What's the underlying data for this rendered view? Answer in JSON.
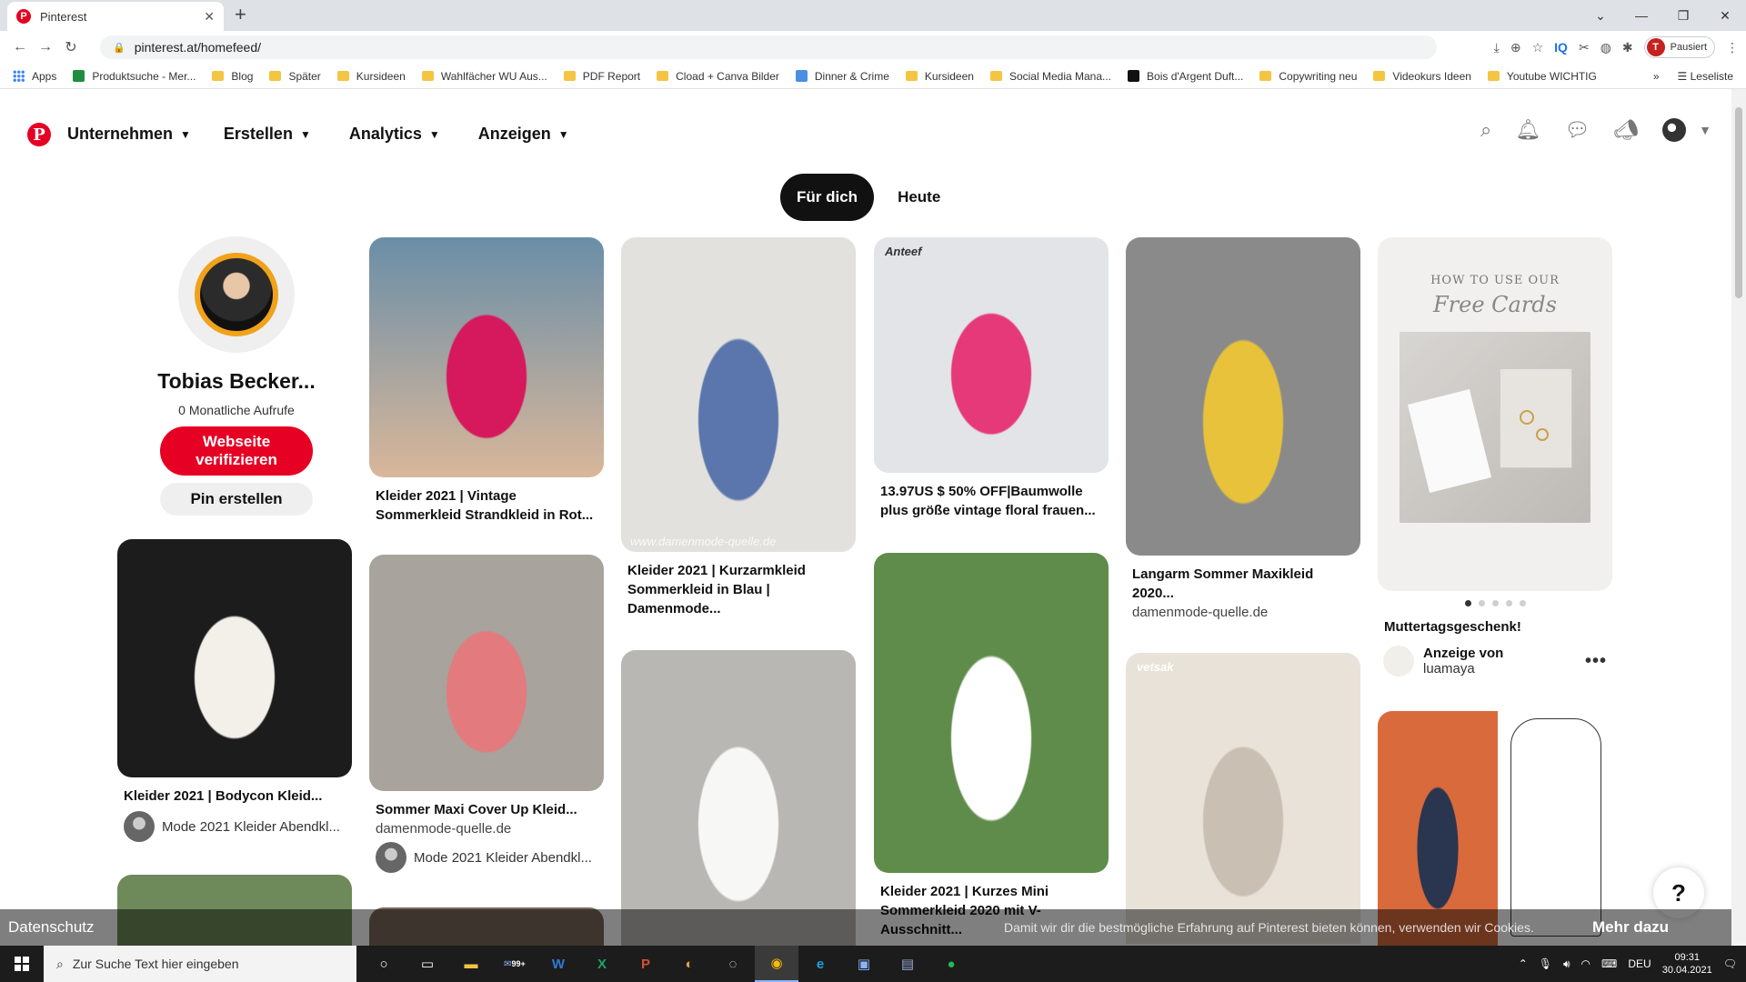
{
  "browser": {
    "tab_title": "Pinterest",
    "url": "pinterest.at/homefeed/",
    "profile_initial": "T",
    "profile_status": "Pausiert",
    "bookmarks": [
      {
        "label": "Apps",
        "kind": "apps"
      },
      {
        "label": "Produktsuche - Mer...",
        "kind": "site",
        "color": "#1e8e3e"
      },
      {
        "label": "Blog",
        "kind": "folder"
      },
      {
        "label": "Später",
        "kind": "folder"
      },
      {
        "label": "Kursideen",
        "kind": "folder"
      },
      {
        "label": "Wahlfächer WU Aus...",
        "kind": "folder"
      },
      {
        "label": "PDF Report",
        "kind": "folder"
      },
      {
        "label": "Cload + Canva Bilder",
        "kind": "folder"
      },
      {
        "label": "Dinner & Crime",
        "kind": "site",
        "color": "#4a90e2"
      },
      {
        "label": "Kursideen",
        "kind": "folder"
      },
      {
        "label": "Social Media Mana...",
        "kind": "folder"
      },
      {
        "label": "Bois d'Argent Duft...",
        "kind": "site",
        "color": "#111111"
      },
      {
        "label": "Copywriting neu",
        "kind": "folder"
      },
      {
        "label": "Videokurs Ideen",
        "kind": "folder"
      },
      {
        "label": "Youtube WICHTIG",
        "kind": "folder"
      }
    ],
    "bookmarks_overflow": "»",
    "reading_list": "Leseliste"
  },
  "header": {
    "logo": "P",
    "nav": [
      {
        "label": "Unternehmen"
      },
      {
        "label": "Erstellen"
      },
      {
        "label": "Analytics"
      },
      {
        "label": "Anzeigen"
      }
    ]
  },
  "feed_tabs": {
    "active": "Für dich",
    "other": "Heute"
  },
  "profile": {
    "name": "Tobias Becker...",
    "views": "0 Monatliche Aufrufe",
    "verify_button": "Webseite verifizieren",
    "create_pin_button": "Pin erstellen"
  },
  "pins": {
    "p1": {
      "title": "Kleider 2021 | Vintage Sommerkleid Strandkleid in Rot...",
      "color_a": "#6a8ea8",
      "color_b": "#d9b79a",
      "accent": "#d6185c"
    },
    "p2": {
      "title": "Kleider 2021 | Kurzarmkleid Sommerkleid in Blau | Damenmode...",
      "watermark": "www.damenmode-quelle.de",
      "color_a": "#e3e1dd",
      "accent": "#5a76ad"
    },
    "p3": {
      "title": "13.97US $ 50% OFF|Baumwolle plus größe vintage floral frauen...",
      "brand": "Anteef",
      "color_a": "#e2e4e7",
      "accent": "#e6397a"
    },
    "p4": {
      "title": "Langarm Sommer Maxikleid 2020...",
      "source": "damenmode-quelle.de",
      "color_a": "#8a8a8a",
      "accent": "#e7c23a"
    },
    "p5": {
      "title": "Muttertagsgeschenk!",
      "ad_label": "Anzeige von",
      "advertiser": "luamaya",
      "card_line1": "HOW TO USE OUR",
      "card_line2": "Free Cards",
      "color_a": "#f1f0ee"
    },
    "p6": {
      "title": "Kleider 2021 | Bodycon Kleid...",
      "attribution": "Mode 2021 Kleider Abendkl...",
      "color_a": "#1c1c1c",
      "accent": "#f3f0ea"
    },
    "p7": {
      "title": "Sommer Maxi Cover Up Kleid...",
      "source": "damenmode-quelle.de",
      "attribution": "Mode 2021 Kleider Abendkl...",
      "color_a": "#a8a39c",
      "accent": "#e27a7e"
    },
    "p8": {
      "title": "Kleider 2021 | Kurzes Mini Sommerkleid 2020 mit V-Ausschnitt...",
      "color_a": "#5f8c4a",
      "accent": "#ffffff"
    },
    "p9": {
      "color_a": "#b9b7b3",
      "accent": "#f7f7f5"
    },
    "p10": {
      "brand": "vetsak",
      "color_a": "#e9e2d8",
      "accent": "#c9bfb2"
    },
    "p11": {
      "color_a": "#d96a3c",
      "accent": "#2a3550"
    },
    "p12": {
      "color_a": "#6e8a5a"
    },
    "p13": {
      "color_a": "#7a6a5a"
    }
  },
  "help": "?",
  "cookie": {
    "privacy": "Datenschutz",
    "message": "Damit wir dir die bestmögliche Erfahrung auf Pinterest bieten können, verwenden wir Cookies.",
    "more": "Mehr dazu"
  },
  "taskbar": {
    "search_placeholder": "Zur Suche Text hier eingeben",
    "mail_badge": "99+",
    "lang": "DEU",
    "time": "09:31",
    "date": "30.04.2021"
  }
}
